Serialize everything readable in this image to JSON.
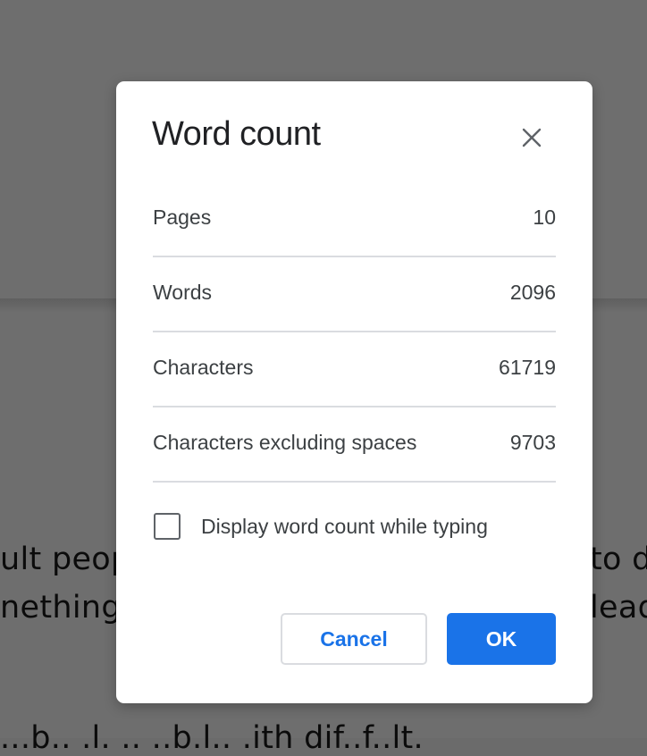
{
  "background": {
    "lines": [
      {
        "left": "ult peop",
        "right": "to d"
      },
      {
        "left": "nething",
        "right": "lead"
      },
      {
        "left": "...b.. .l. .. ..b.l.. .ith dif..f..lt."
      }
    ]
  },
  "dialog": {
    "title": "Word count",
    "close_icon": "close-icon",
    "stats": [
      {
        "label": "Pages",
        "value": "10"
      },
      {
        "label": "Words",
        "value": "2096"
      },
      {
        "label": "Characters",
        "value": "61719"
      },
      {
        "label": "Characters excluding spaces",
        "value": "9703"
      }
    ],
    "checkbox": {
      "label": "Display word count while typing",
      "checked": false
    },
    "buttons": {
      "cancel": "Cancel",
      "ok": "OK"
    }
  },
  "colors": {
    "accent": "#1a73e8",
    "overlay": "#6e6e6e"
  }
}
